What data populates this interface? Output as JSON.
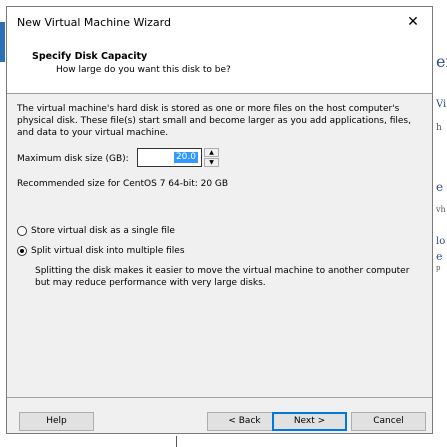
{
  "dialog": {
    "title": "New Virtual Machine Wizard",
    "close_glyph": "✕"
  },
  "header": {
    "title": "Specify Disk Capacity",
    "subtitle": "How large do you want this disk to be?"
  },
  "description": "The virtual machine's hard disk is stored as one or more files on the host computer's physical disk. These file(s) start small and become larger as you add applications, files, and data to your virtual machine.",
  "disk_size": {
    "label": "Maximum disk size (GB):",
    "value": "20.0"
  },
  "recommendation": "Recommended size for CentOS 7 64-bit: 20 GB",
  "storage_options": [
    {
      "label": "Store virtual disk as a single file",
      "selected": false
    },
    {
      "label": "Split virtual disk into multiple files",
      "selected": true
    }
  ],
  "split_description": "Splitting the disk makes it easier to move the virtual machine to another computer but may reduce performance with very large disks.",
  "buttons": {
    "help": "Help",
    "back": "< Back",
    "next": "Next >",
    "cancel": "Cancel"
  },
  "background": {
    "right_fragments": [
      "er",
      "Vi",
      "h",
      "e",
      "vh",
      "lo",
      "e",
      "p"
    ]
  }
}
